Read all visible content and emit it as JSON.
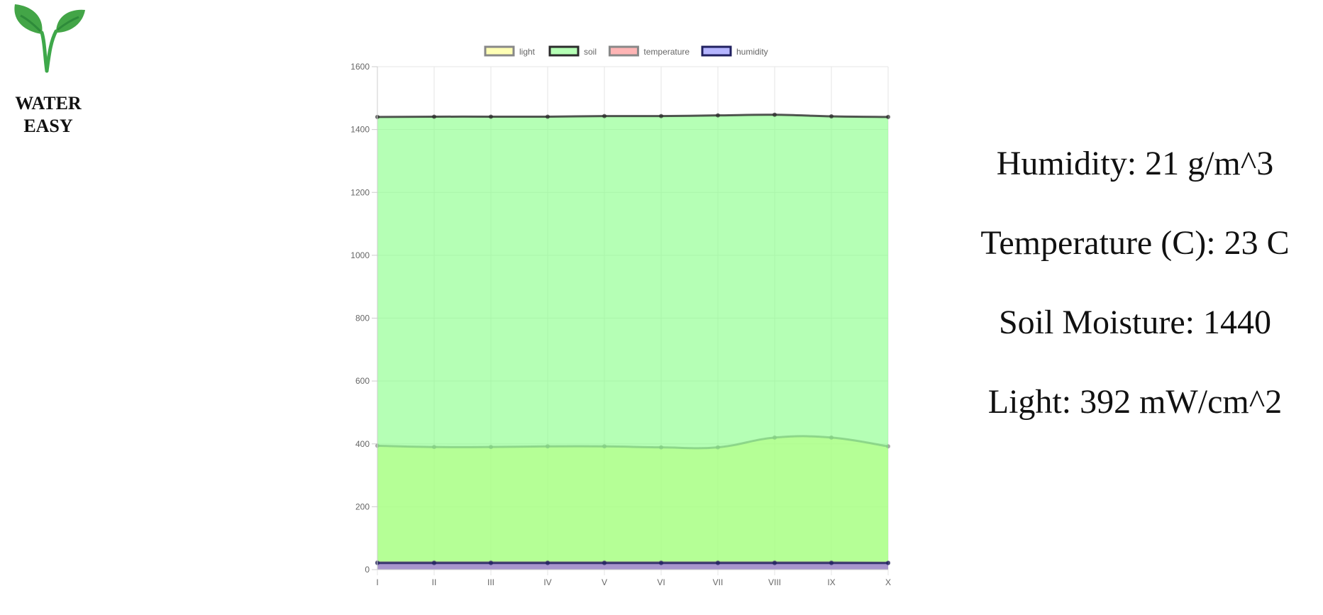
{
  "brand": {
    "line1": "WATER",
    "line2": "EASY",
    "icon": "sprout-icon",
    "color": "#3ea84a"
  },
  "readouts": [
    {
      "label": "Humidity: ",
      "value": "21 g/m^3"
    },
    {
      "label": "Temperature (C): ",
      "value": "23 C"
    },
    {
      "label": "Soil Moisture: ",
      "value": "1440"
    },
    {
      "label": "Light: ",
      "value": "392 mW/cm^2"
    }
  ],
  "chart_data": {
    "type": "area",
    "categories": [
      "I",
      "II",
      "III",
      "IV",
      "V",
      "VI",
      "VII",
      "VIII",
      "IX",
      "X"
    ],
    "ylim": [
      0,
      1600
    ],
    "yticks": [
      0,
      200,
      400,
      600,
      800,
      1000,
      1200,
      1400,
      1600
    ],
    "grid": true,
    "legend_position": "top",
    "series": [
      {
        "name": "light",
        "values": [
          394,
          390,
          390,
          392,
          392,
          389,
          389,
          420,
          420,
          392
        ],
        "fill": "#ffff80",
        "border": "#888888"
      },
      {
        "name": "soil",
        "values": [
          1440,
          1441,
          1441,
          1441,
          1443,
          1443,
          1445,
          1447,
          1442,
          1440
        ],
        "fill": "#80ff80",
        "border": "#2b2b2b"
      },
      {
        "name": "temperature",
        "values": [
          23,
          23,
          23,
          23,
          23,
          23,
          23,
          23,
          23,
          22
        ],
        "fill": "#ff8080",
        "border": "#888888"
      },
      {
        "name": "humidity",
        "values": [
          21,
          21,
          21,
          21,
          21,
          21,
          21,
          21,
          21,
          21
        ],
        "fill": "#8080ff",
        "border": "#202060"
      }
    ]
  }
}
